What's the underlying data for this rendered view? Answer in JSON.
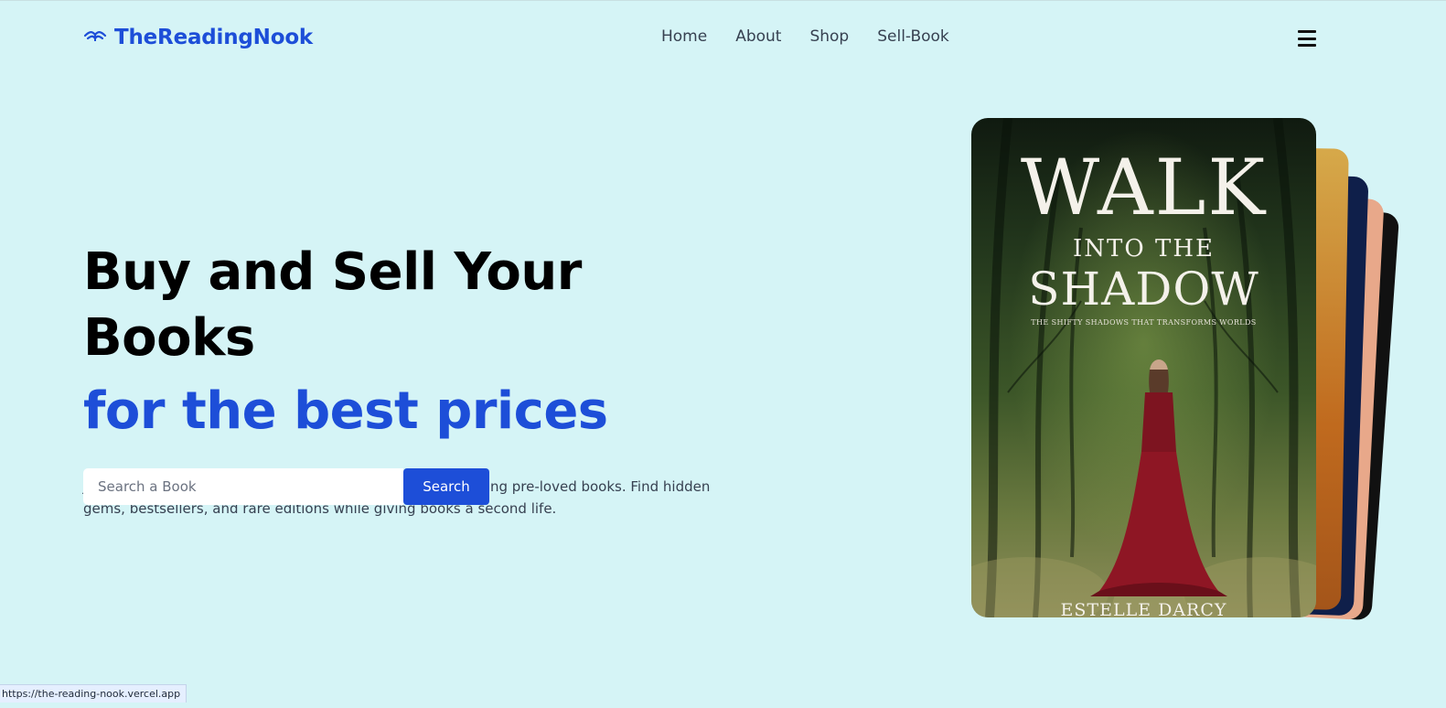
{
  "brand": {
    "name": "TheReadingNook",
    "accent": "#1d4ed8"
  },
  "nav": {
    "links": [
      {
        "label": "Home"
      },
      {
        "label": "About"
      },
      {
        "label": "Shop"
      },
      {
        "label": "Sell-Book"
      }
    ]
  },
  "hero": {
    "headline": "Buy and Sell Your Books",
    "subheadline": "for the best prices",
    "description": "Join thousands of book lovers buying, selling, and exchanging pre-loved books. Find hidden gems, bestsellers, and rare editions while giving books a second life."
  },
  "search": {
    "placeholder": "Search a Book",
    "value": "",
    "button_label": "Search"
  },
  "featured_book": {
    "title_line1": "WALK",
    "title_line2": "INTO THE",
    "title_line3": "SHADOW",
    "tagline": "THE SHIFTY SHADOWS THAT TRANSFORMS WORLDS",
    "author": "ESTELLE DARCY"
  },
  "status_bar": {
    "url": "https://the-reading-nook.vercel.app"
  },
  "colors": {
    "background": "#d5f4f6",
    "primary": "#1d4ed8",
    "text": "#374151"
  }
}
